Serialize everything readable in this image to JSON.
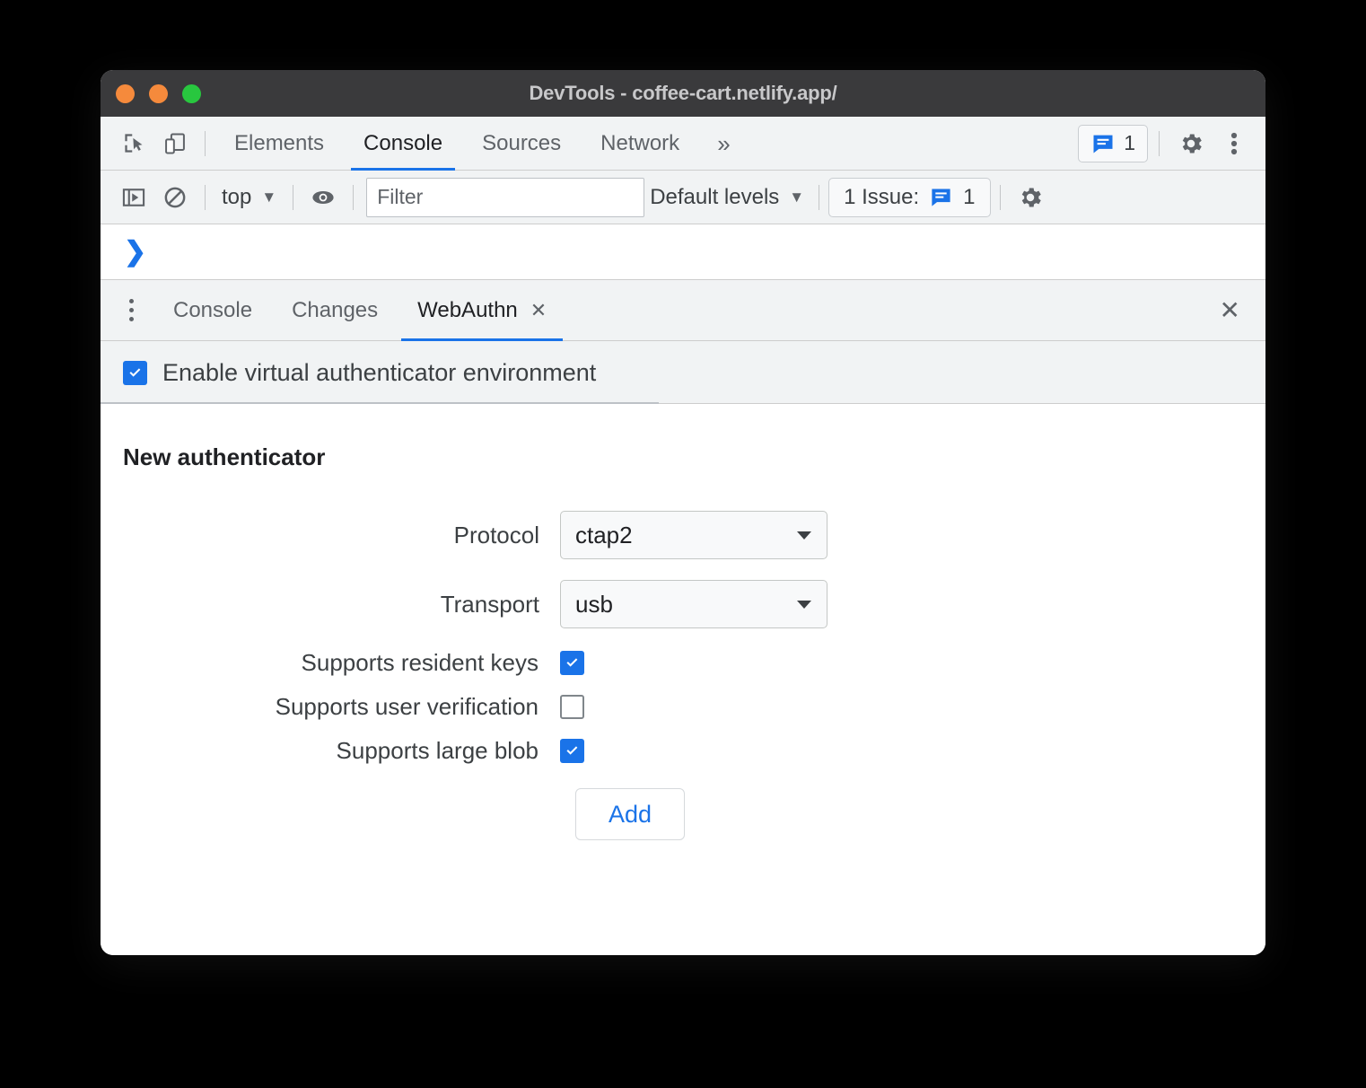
{
  "window": {
    "title": "DevTools - coffee-cart.netlify.app/",
    "traffic_lights": [
      {
        "name": "close",
        "color": "#f58a3c"
      },
      {
        "name": "minimize",
        "color": "#f58a3c"
      },
      {
        "name": "maximize",
        "color": "#28c73f"
      }
    ]
  },
  "main_toolbar": {
    "icons": [
      {
        "name": "inspect-element-icon",
        "label": "Inspect element"
      },
      {
        "name": "device-toolbar-icon",
        "label": "Toggle device toolbar"
      }
    ],
    "tabs": [
      {
        "label": "Elements",
        "active": false
      },
      {
        "label": "Console",
        "active": true
      },
      {
        "label": "Sources",
        "active": false
      },
      {
        "label": "Network",
        "active": false
      }
    ],
    "more_tabs": "»",
    "issues_count": "1",
    "settings_label": "Settings",
    "more_options_label": "Customize and control DevTools"
  },
  "filter_toolbar": {
    "sidebar_toggle": "Show console sidebar",
    "clear_console": "Clear console",
    "context": "top",
    "context_caret": "▼",
    "live_expression": "Create live expression",
    "filter_placeholder": "Filter",
    "filter_value": "",
    "levels": "Default levels",
    "levels_caret": "▼",
    "issues_text": "1 Issue:",
    "issues_count": "1",
    "settings_label": "Console settings"
  },
  "console": {
    "prompt": "❯"
  },
  "drawer": {
    "menu_label": "More tools",
    "tabs": [
      {
        "label": "Console",
        "active": false,
        "closable": false
      },
      {
        "label": "Changes",
        "active": false,
        "closable": false
      },
      {
        "label": "WebAuthn",
        "active": true,
        "closable": true,
        "close_glyph": "✕"
      }
    ],
    "close_glyph": "✕"
  },
  "webauthn": {
    "enable_label": "Enable virtual authenticator environment",
    "enable_checked": true,
    "section_title": "New authenticator",
    "fields": [
      {
        "label": "Protocol",
        "value": "ctap2",
        "type": "select"
      },
      {
        "label": "Transport",
        "value": "usb",
        "type": "select"
      }
    ],
    "checkboxes": [
      {
        "label": "Supports resident keys",
        "checked": true
      },
      {
        "label": "Supports user verification",
        "checked": false
      },
      {
        "label": "Supports large blob",
        "checked": true
      }
    ],
    "add_label": "Add"
  },
  "colors": {
    "accent_blue": "#1a73e8",
    "titlebar_bg": "#3a3a3c",
    "toolbar_bg": "#f1f3f4",
    "panel_bg": "#ffffff",
    "text_primary": "#202124",
    "text_secondary": "#5f6368"
  }
}
